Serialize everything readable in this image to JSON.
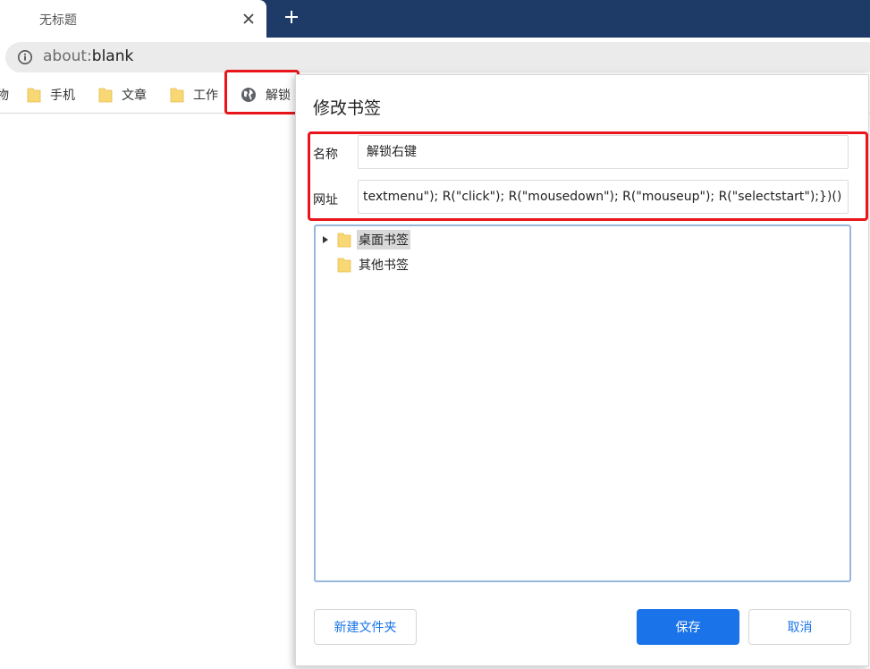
{
  "browser": {
    "tab_title": "无标题",
    "new_tab_symbol": "+",
    "address": {
      "scheme": "about:",
      "path": "blank"
    }
  },
  "bookmarks_bar": {
    "items": [
      {
        "label": "物",
        "icon": "none"
      },
      {
        "label": "手机",
        "icon": "folder-icon"
      },
      {
        "label": "文章",
        "icon": "folder-icon"
      },
      {
        "label": "工作",
        "icon": "folder-icon"
      },
      {
        "label": "解锁",
        "icon": "globe-icon"
      }
    ]
  },
  "dialog": {
    "title": "修改书签",
    "name_label": "名称",
    "name_value": "解锁右键",
    "url_label": "网址",
    "url_value": "textmenu\"); R(\"click\"); R(\"mousedown\"); R(\"mouseup\"); R(\"selectstart\");})()",
    "folders": [
      {
        "label": "桌面书签",
        "expandable": true,
        "selected": true
      },
      {
        "label": "其他书签",
        "expandable": false,
        "selected": false
      }
    ],
    "new_folder_button": "新建文件夹",
    "save_button": "保存",
    "cancel_button": "取消"
  },
  "colors": {
    "tabstrip": "#1e3a66",
    "highlight": "#e8161b",
    "primary": "#1a73e8",
    "folder": "#f8d775"
  }
}
